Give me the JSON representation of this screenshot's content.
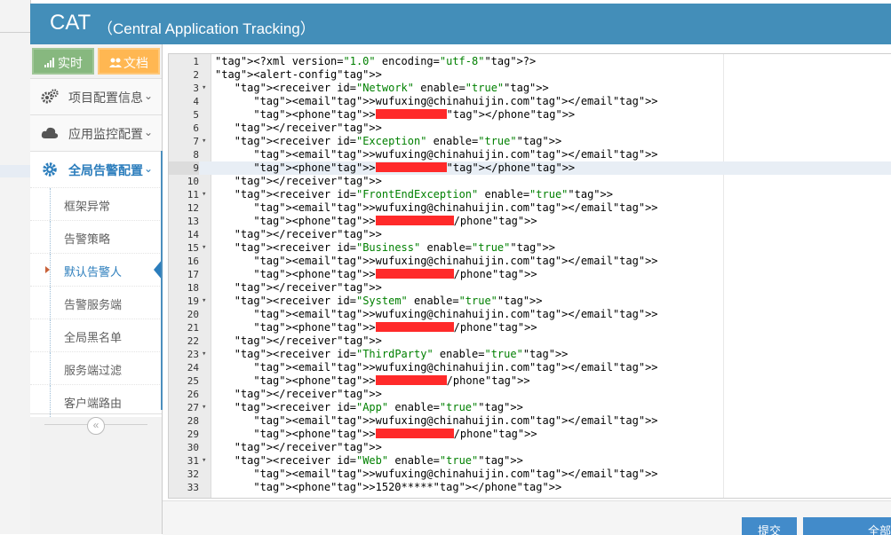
{
  "header": {
    "logo": "CAT",
    "subtitle": "（Central Application Tracking）"
  },
  "shortcuts": {
    "realtime_label": "实时",
    "docs_label": "文档"
  },
  "nav": {
    "project_config": "项目配置信息",
    "app_monitor": "应用监控配置",
    "global_alert": "全局告警配置",
    "sub_items": [
      "框架异常",
      "告警策略",
      "默认告警人",
      "告警服务端",
      "全局黑名单",
      "服务端过滤",
      "客户端路由"
    ],
    "active_sub_index": 2,
    "collapse_glyph": "«"
  },
  "editor": {
    "cursor_line": 9,
    "lines": [
      {
        "n": "1",
        "fold": "",
        "text": "<?xml version=\"1.0\" encoding=\"utf-8\"?>"
      },
      {
        "n": "2",
        "fold": "",
        "text": "<alert-config>"
      },
      {
        "n": "3",
        "fold": "▾",
        "text": "   <receiver id=\"Network\" enable=\"true\">"
      },
      {
        "n": "4",
        "fold": "",
        "text": "      <email>wufuxing@chinahuijin.com</email>"
      },
      {
        "n": "5",
        "fold": "",
        "text": "      <phone>[redacted]</phone>"
      },
      {
        "n": "6",
        "fold": "",
        "text": "   </receiver>"
      },
      {
        "n": "7",
        "fold": "▾",
        "text": "   <receiver id=\"Exception\" enable=\"true\">"
      },
      {
        "n": "8",
        "fold": "",
        "text": "      <email>wufuxing@chinahuijin.com</email>"
      },
      {
        "n": "9",
        "fold": "",
        "text": "      <phone>[redacted]</phone>"
      },
      {
        "n": "10",
        "fold": "",
        "text": "   </receiver>"
      },
      {
        "n": "11",
        "fold": "▾",
        "text": "   <receiver id=\"FrontEndException\" enable=\"true\">"
      },
      {
        "n": "12",
        "fold": "",
        "text": "      <email>wufuxing@chinahuijin.com</email>"
      },
      {
        "n": "13",
        "fold": "",
        "text": "      <phone>[redacted]/phone>"
      },
      {
        "n": "14",
        "fold": "",
        "text": "   </receiver>"
      },
      {
        "n": "15",
        "fold": "▾",
        "text": "   <receiver id=\"Business\" enable=\"true\">"
      },
      {
        "n": "16",
        "fold": "",
        "text": "      <email>wufuxing@chinahuijin.com</email>"
      },
      {
        "n": "17",
        "fold": "",
        "text": "      <phone>[redacted]/phone>"
      },
      {
        "n": "18",
        "fold": "",
        "text": "   </receiver>"
      },
      {
        "n": "19",
        "fold": "▾",
        "text": "   <receiver id=\"System\" enable=\"true\">"
      },
      {
        "n": "20",
        "fold": "",
        "text": "      <email>wufuxing@chinahuijin.com</email>"
      },
      {
        "n": "21",
        "fold": "",
        "text": "      <phone>[redacted]/phone>"
      },
      {
        "n": "22",
        "fold": "",
        "text": "   </receiver>"
      },
      {
        "n": "23",
        "fold": "▾",
        "text": "   <receiver id=\"ThirdParty\" enable=\"true\">"
      },
      {
        "n": "24",
        "fold": "",
        "text": "      <email>wufuxing@chinahuijin.com</email>"
      },
      {
        "n": "25",
        "fold": "",
        "text": "      <phone>[redacted]/phone>"
      },
      {
        "n": "26",
        "fold": "",
        "text": "   </receiver>"
      },
      {
        "n": "27",
        "fold": "▾",
        "text": "   <receiver id=\"App\" enable=\"true\">"
      },
      {
        "n": "28",
        "fold": "",
        "text": "      <email>wufuxing@chinahuijin.com</email>"
      },
      {
        "n": "29",
        "fold": "",
        "text": "      <phone>[redacted]/phone>"
      },
      {
        "n": "30",
        "fold": "",
        "text": "   </receiver>"
      },
      {
        "n": "31",
        "fold": "▾",
        "text": "   <receiver id=\"Web\" enable=\"true\">"
      },
      {
        "n": "32",
        "fold": "",
        "text": "      <email>wufuxing@chinahuijin.com</email>"
      },
      {
        "n": "33",
        "fold": "",
        "text": "      <phone>1520*****</phone>"
      }
    ]
  },
  "footer": {
    "submit_label": "提交",
    "all_label": "全部"
  },
  "colors": {
    "header_bg": "#438eb9",
    "redaction": "#ff2a2a",
    "accent": "#2b7dbc"
  }
}
